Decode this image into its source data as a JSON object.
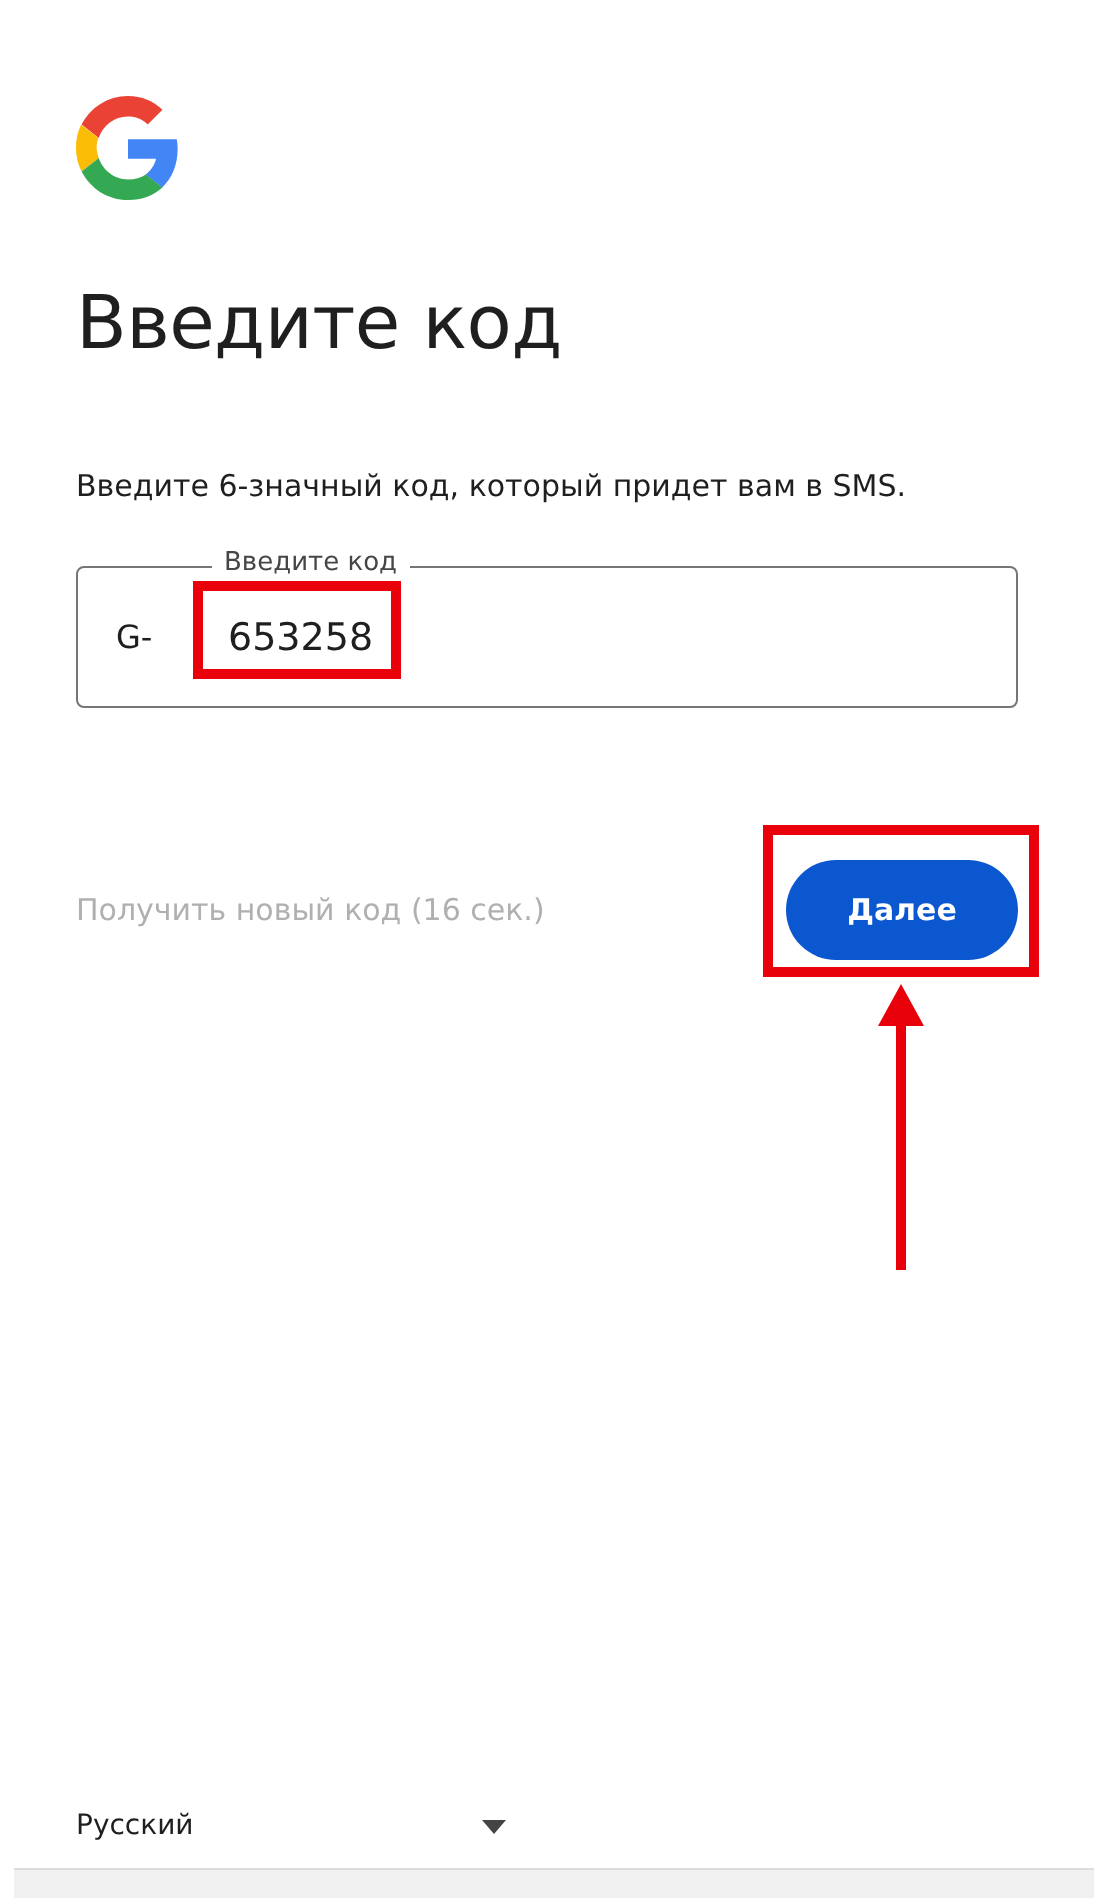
{
  "heading": "Введите код",
  "instructions": "Введите 6-значный код, который придет вам в SMS.",
  "code_field": {
    "label": "Введите код",
    "prefix": "G-",
    "value": "653258"
  },
  "resend_link": {
    "label": "Получить новый код (16 сек.)",
    "disabled": true
  },
  "next_button": {
    "label": "Далее"
  },
  "language_selector": {
    "value": "Русский"
  }
}
